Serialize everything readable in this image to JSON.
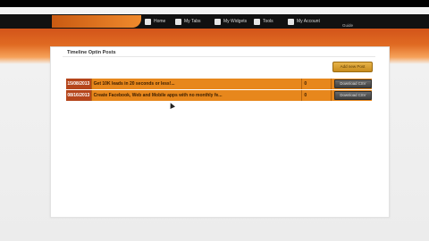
{
  "nav": {
    "items": [
      {
        "label": "Home",
        "icon": "home-icon"
      },
      {
        "label": "My Tabs",
        "icon": "tabs-icon"
      },
      {
        "label": "My Widgets",
        "icon": "widgets-icon"
      },
      {
        "label": "Tools",
        "icon": "tools-icon"
      },
      {
        "label": "My Account",
        "icon": "account-icon"
      }
    ],
    "sub_label": "Guide"
  },
  "panel": {
    "title": "Timeline Optin Posts",
    "add_button": "Add new Post"
  },
  "posts": [
    {
      "date": "15/08/2013",
      "title": "Get 10K leads in 20 seconds or less!...",
      "count": "0",
      "action": "Download CSV"
    },
    {
      "date": "08/16/2013",
      "title": "Create Facebook, Web and Mobile apps with no monthly fe...",
      "count": "0",
      "action": "Download CSV"
    }
  ],
  "colors": {
    "brand_orange": "#e06a22",
    "row_orange": "#e7871c",
    "date_red": "#b5451b",
    "button_gold": "#d9a036"
  }
}
